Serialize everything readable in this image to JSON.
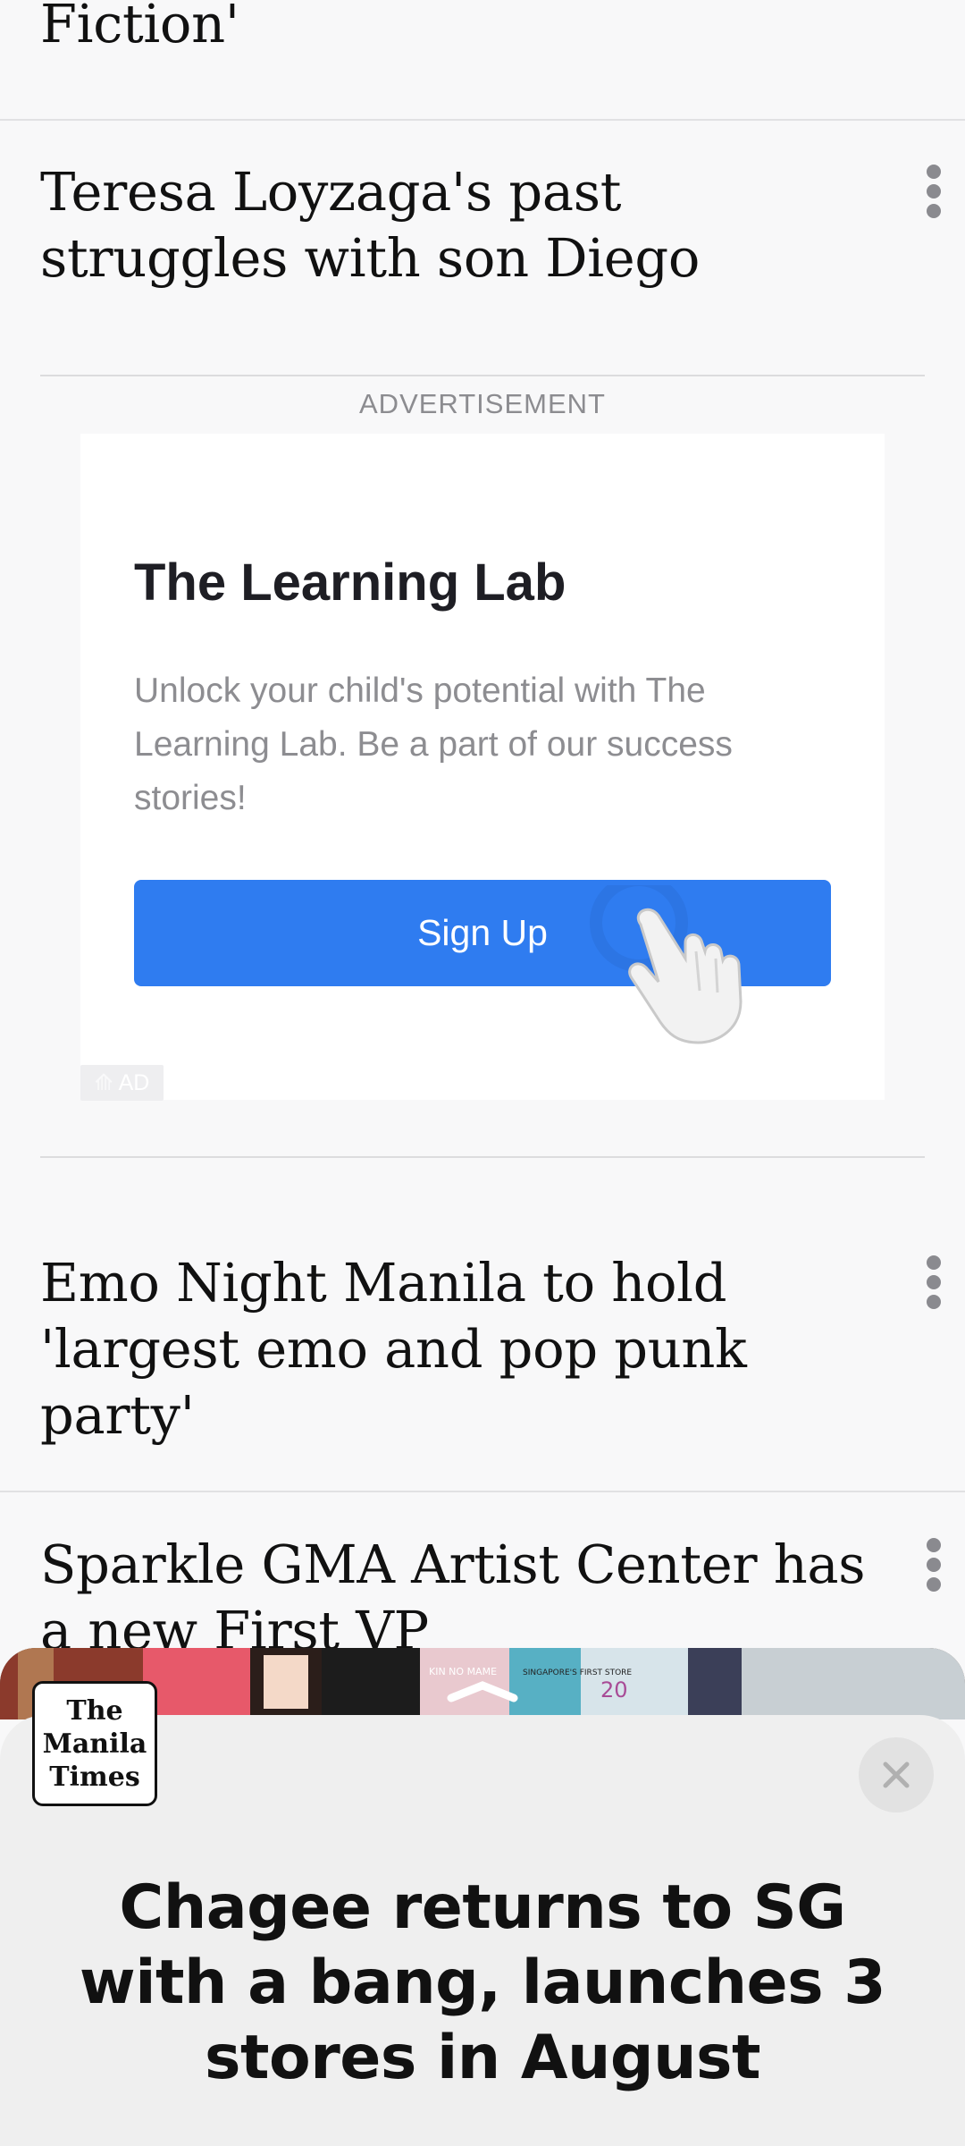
{
  "feed": {
    "items": [
      {
        "headline": "Fiction'"
      },
      {
        "headline": "Teresa Loyzaga's past struggles with son Diego"
      },
      {
        "headline": "Emo Night Manila to hold 'largest emo and pop punk party'"
      },
      {
        "headline": "Sparkle GMA Artist Center has a new First VP"
      }
    ]
  },
  "advertisement": {
    "label": "ADVERTISEMENT",
    "title": "The Learning Lab",
    "body": "Unlock your child's potential with The Learning Lab. Be a part of our success stories!",
    "button_label": "Sign Up",
    "badge": "AD",
    "button_color": "#2f7cf0"
  },
  "bottom_sheet": {
    "logo_lines": [
      "The",
      "Manila",
      "Times"
    ],
    "story_title": "Chagee returns to SG with a bang, launches 3 stores in August",
    "photo_signs": [
      "KIN NO MAME",
      "SINGAPORE'S FIRST STORE",
      "20"
    ]
  },
  "icons": {
    "more": "more-vertical-icon",
    "close": "close-icon",
    "handle": "chevron-up-icon",
    "tap": "tap-hand-icon"
  }
}
